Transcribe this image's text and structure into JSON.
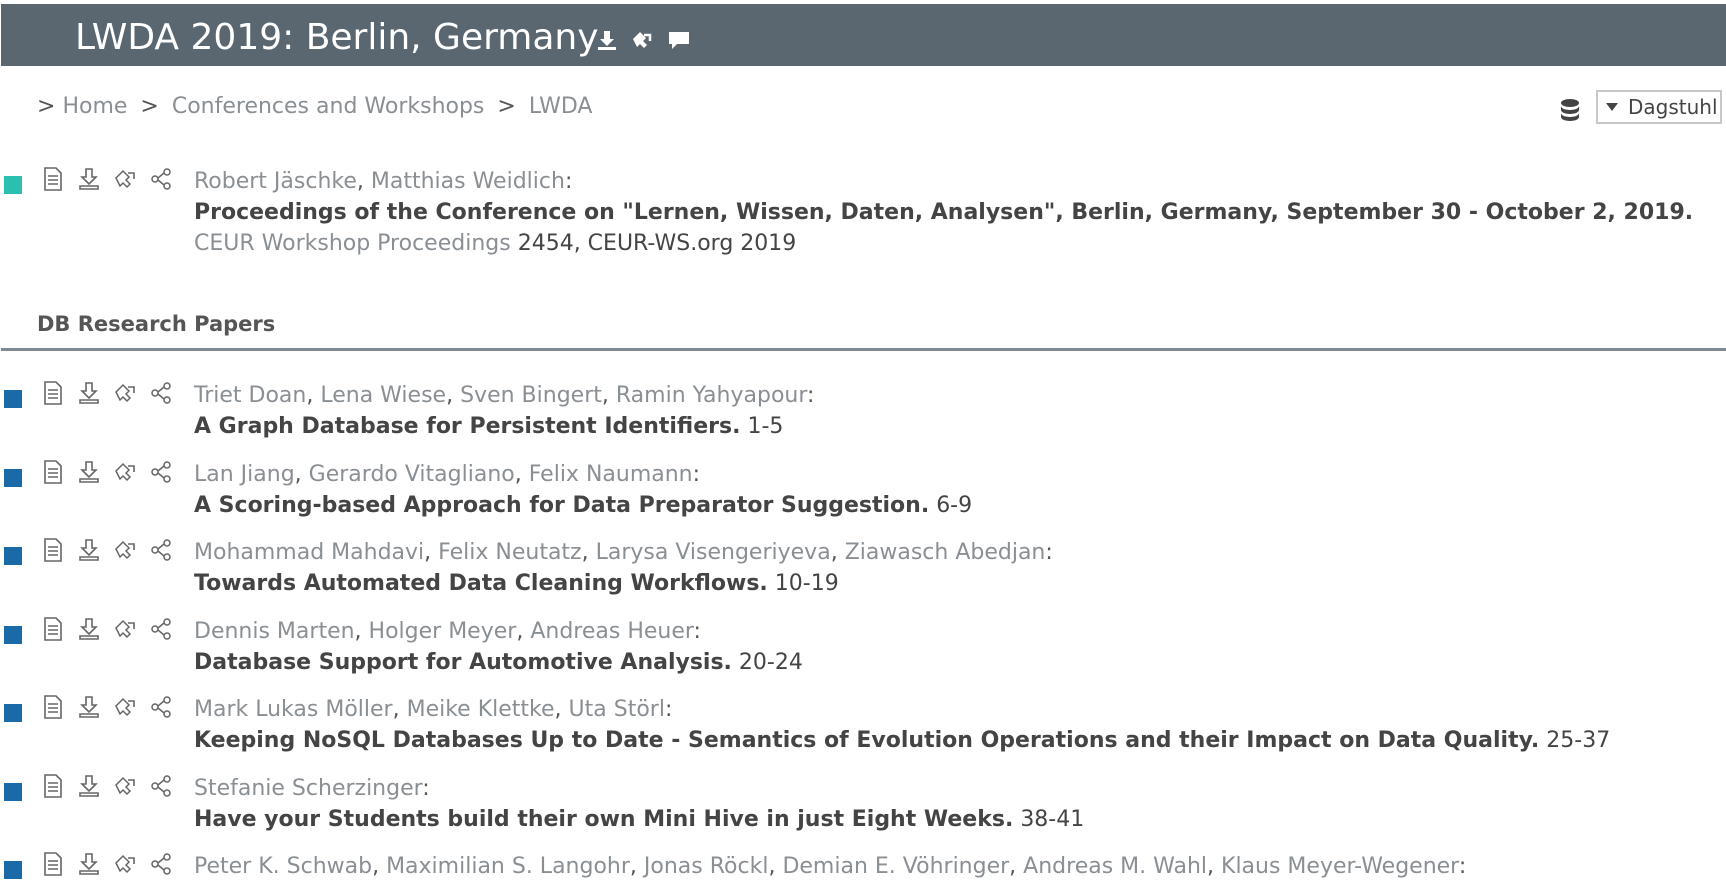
{
  "header": {
    "title": "LWDA 2019: Berlin, Germany",
    "icons": [
      "download-icon",
      "bibtex-icon",
      "comment-icon"
    ]
  },
  "breadcrumb": {
    "prefix": ">",
    "items": [
      "Home",
      "Conferences and Workshops",
      "LWDA"
    ]
  },
  "mirror": {
    "label": "Dagstuhl"
  },
  "proceedings": {
    "authors": [
      "Robert Jäschke",
      "Matthias Weidlich"
    ],
    "title": "Proceedings of the Conference on \"Lernen, Wissen, Daten, Analysen\", Berlin, Germany, September 30 - October 2, 2019.",
    "venue": "CEUR Workshop Proceedings",
    "volume": "2454, CEUR-WS.org 2019",
    "marker_color": "#2bbfb0"
  },
  "section": {
    "title": "DB Research Papers"
  },
  "colors": {
    "header_bg": "#5b6770",
    "paper_marker": "#1a6aa8",
    "link_gray": "#8a8f94"
  },
  "papers": [
    {
      "authors": [
        "Triet Doan",
        "Lena Wiese",
        "Sven Bingert",
        "Ramin Yahyapour"
      ],
      "title": "A Graph Database for Persistent Identifiers.",
      "pages": "1-5"
    },
    {
      "authors": [
        "Lan Jiang",
        "Gerardo Vitagliano",
        "Felix Naumann"
      ],
      "title": "A Scoring-based Approach for Data Preparator Suggestion.",
      "pages": "6-9"
    },
    {
      "authors": [
        "Mohammad Mahdavi",
        "Felix Neutatz",
        "Larysa Visengeriyeva",
        "Ziawasch Abedjan"
      ],
      "title": "Towards Automated Data Cleaning Workflows.",
      "pages": "10-19"
    },
    {
      "authors": [
        "Dennis Marten",
        "Holger Meyer",
        "Andreas Heuer"
      ],
      "title": "Database Support for Automotive Analysis.",
      "pages": "20-24"
    },
    {
      "authors": [
        "Mark Lukas Möller",
        "Meike Klettke",
        "Uta Störl"
      ],
      "title": "Keeping NoSQL Databases Up to Date - Semantics of Evolution Operations and their Impact on Data Quality.",
      "pages": "25-37"
    },
    {
      "authors": [
        "Stefanie Scherzinger"
      ],
      "title": "Have your Students build their own Mini Hive in just Eight Weeks.",
      "pages": "38-41"
    },
    {
      "authors": [
        "Peter K. Schwab",
        "Maximilian S. Langohr",
        "Jonas Röckl",
        "Demian E. Vöhringer",
        "Andreas M. Wahl",
        "Klaus Meyer-Wegener"
      ],
      "title": "",
      "pages": ""
    }
  ]
}
